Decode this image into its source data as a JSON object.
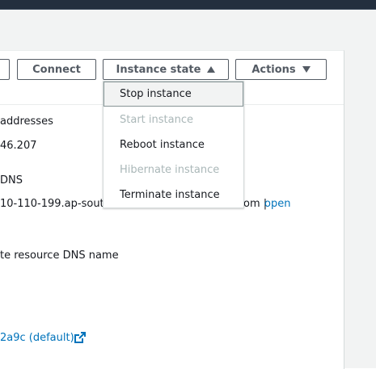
{
  "toolbar": {
    "connect_label": "Connect",
    "instance_state_label": "Instance state",
    "actions_label": "Actions"
  },
  "details": {
    "addresses_label": "addresses",
    "ip_fragment": "46.207",
    "dns_label": "DNS",
    "dns_value_start": "10-110-199.ap-sout",
    "dns_value_end": "om |",
    "open_link": "open",
    "resource_dns_label": "te resource DNS name",
    "vpc_link": "2a9c (default)"
  },
  "instance_state_menu": {
    "items": [
      {
        "label": "Stop instance",
        "enabled": true
      },
      {
        "label": "Start instance",
        "enabled": false
      },
      {
        "label": "Reboot instance",
        "enabled": true
      },
      {
        "label": "Hibernate instance",
        "enabled": false
      },
      {
        "label": "Terminate instance",
        "enabled": true
      }
    ]
  },
  "colors": {
    "link": "#0073bb",
    "disabled_text": "#aab7b8",
    "button_border": "#545b64",
    "header": "#232f3e"
  }
}
